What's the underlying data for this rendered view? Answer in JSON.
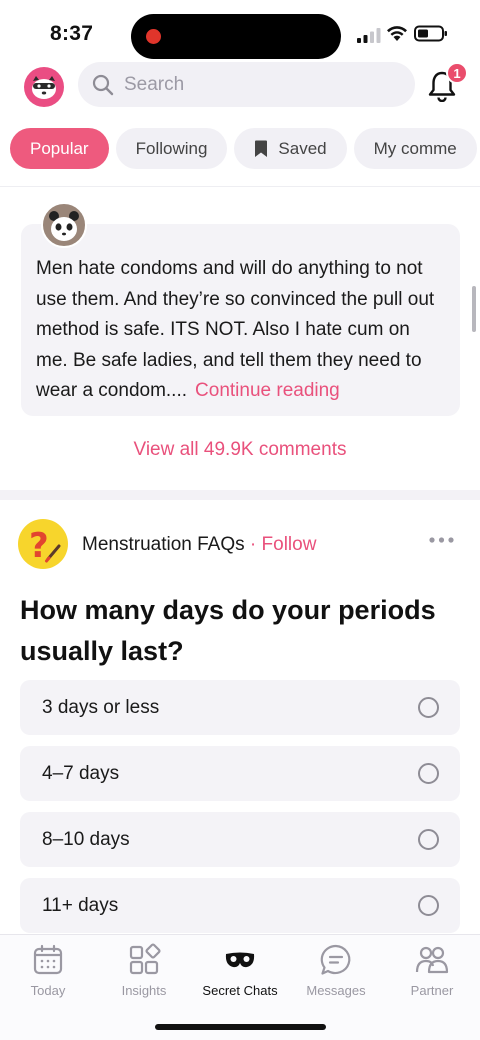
{
  "status_bar": {
    "time": "8:37"
  },
  "header": {
    "search_placeholder": "Search",
    "notification_count": "1"
  },
  "tabs": [
    {
      "label": "Popular",
      "active": true
    },
    {
      "label": "Following",
      "active": false
    },
    {
      "label": "Saved",
      "active": false,
      "icon": "bookmark-icon"
    },
    {
      "label": "My comme",
      "active": false
    }
  ],
  "comment": {
    "text": "Men hate condoms and will do anything to not use them. And they’re so convinced the pull out method is safe. ITS NOT. Also I hate cum on me. Be safe ladies, and tell them they need to wear a condom....",
    "continue_label": "Continue reading",
    "view_all_label": "View all 49.9K comments"
  },
  "post": {
    "source": "Menstruation FAQs",
    "separator": "·",
    "follow_label": "Follow",
    "title": "How many days do your periods usually last?",
    "options": [
      {
        "label": "3 days or less"
      },
      {
        "label": "4–7 days"
      },
      {
        "label": "8–10 days"
      },
      {
        "label": "11+ days"
      }
    ]
  },
  "bottom_nav": {
    "items": [
      {
        "label": "Today",
        "icon": "calendar-icon",
        "active": false
      },
      {
        "label": "Insights",
        "icon": "grid-icon",
        "active": false
      },
      {
        "label": "Secret Chats",
        "icon": "mask-icon",
        "active": true
      },
      {
        "label": "Messages",
        "icon": "chat-bubble-icon",
        "active": false
      },
      {
        "label": "Partner",
        "icon": "partner-icon",
        "active": false
      }
    ]
  },
  "colors": {
    "accent": "#ee5a7e",
    "link": "#e9517c",
    "chip_bg": "#f1f0f5",
    "card_bg": "#f4f3f7"
  }
}
